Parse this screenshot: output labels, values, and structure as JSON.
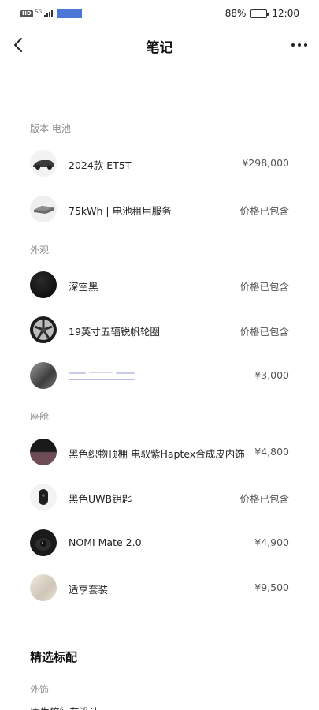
{
  "status_bar": {
    "hd": "HD",
    "network": "5G",
    "battery_percent": "88%",
    "battery_level": 0.88,
    "time": "12:00"
  },
  "nav": {
    "back_icon": "chevron-left-icon",
    "title": "笔记",
    "more_icon": "more-horizontal-icon"
  },
  "sections": {
    "version_battery": "版本 电池",
    "exterior": "外观",
    "cabin": "座舱"
  },
  "items": [
    {
      "name": "2024款 ET5T",
      "price": "¥298,000",
      "thumb": "car-side-thumb"
    },
    {
      "name": "75kWh | 电池租用服务",
      "price": "价格已包含",
      "thumb": "battery-pack-thumb"
    },
    {
      "name": "深空黑",
      "price": "价格已包含",
      "thumb": "black-paint-swatch"
    },
    {
      "name": "19英寸五辐锐帆轮圈",
      "price": "价格已包含",
      "thumb": "wheel-rim-thumb"
    },
    {
      "name": "",
      "price": "¥3,000",
      "thumb": "exterior-option-thumb"
    },
    {
      "name": "黑色织物顶棚 电驭紫Haptex合成皮内饰",
      "price": "¥4,800",
      "thumb": "interior-swatch-thumb"
    },
    {
      "name": "黑色UWB钥匙",
      "price": "价格已包含",
      "thumb": "uwb-key-thumb"
    },
    {
      "name": "NOMI Mate 2.0",
      "price": "¥4,900",
      "thumb": "nomi-device-thumb"
    },
    {
      "name": "适享套装",
      "price": "¥9,500",
      "thumb": "comfort-package-thumb"
    }
  ],
  "featured": {
    "heading": "精选标配",
    "sub_label": "外饰",
    "partial_line": "原生旅行车设计"
  },
  "colors": {
    "redaction_blue": "#4b78d6",
    "label_gray": "#8c8c8c",
    "price_gray": "#555555"
  }
}
